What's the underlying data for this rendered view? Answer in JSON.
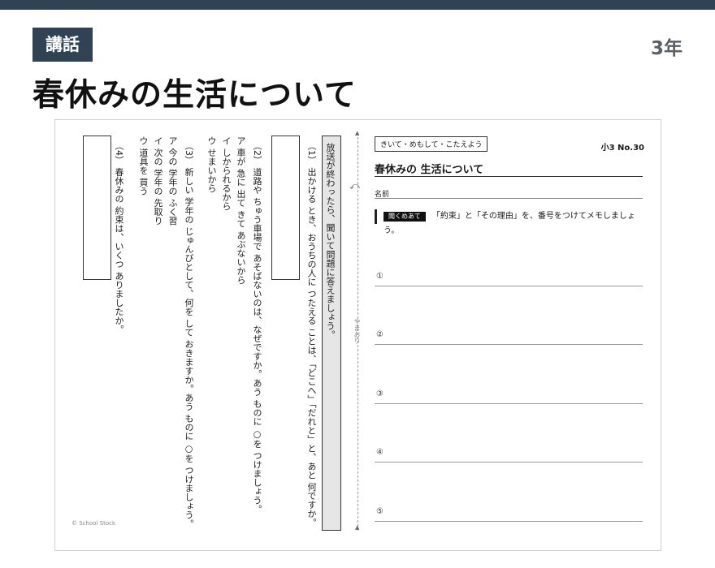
{
  "header": {
    "tag": "講話",
    "grade": "3年",
    "title": "春休みの生活について"
  },
  "sheet": {
    "instruction": "放送が終わったら、聞いて問題に答えましょう。",
    "q1": "（1） 出かける とき、おうちの人に つたえる ことは、「どこへ」「だれと」と、あと 何ですか。",
    "q2": "（2） 道路や ちゅう車場で あそばないのは、なぜですか。あう ものに ○を つけましょう。",
    "q2_options": [
      "ア 車が 急に 出て きて あぶないから",
      "イ しかられるから",
      "ウ せまいから"
    ],
    "q3": "（3） 新しい 学年の じゅんびとして、何を して おきますか。あう ものに ○を つけましょう。",
    "q3_options": [
      "ア 今の 学年の ふく習",
      "イ 次の 学年の 先取り",
      "ウ 道具を 買う"
    ],
    "q4": "（4） 春休みの 約束は、いくつ ありましたか。",
    "fold_label": "やまおり",
    "box_label": "きいて・めもして・こたえよう",
    "number": "小3 No.30",
    "title": "春休みの 生活について",
    "name_label": "名前",
    "listen_label": "聞くめあて",
    "listen_text": "「約束」と「その理由」を、番号をつけてメモしましょう。",
    "memo_numbers": [
      "①",
      "②",
      "③",
      "④",
      "⑤"
    ],
    "copyright": "© School Stock"
  }
}
